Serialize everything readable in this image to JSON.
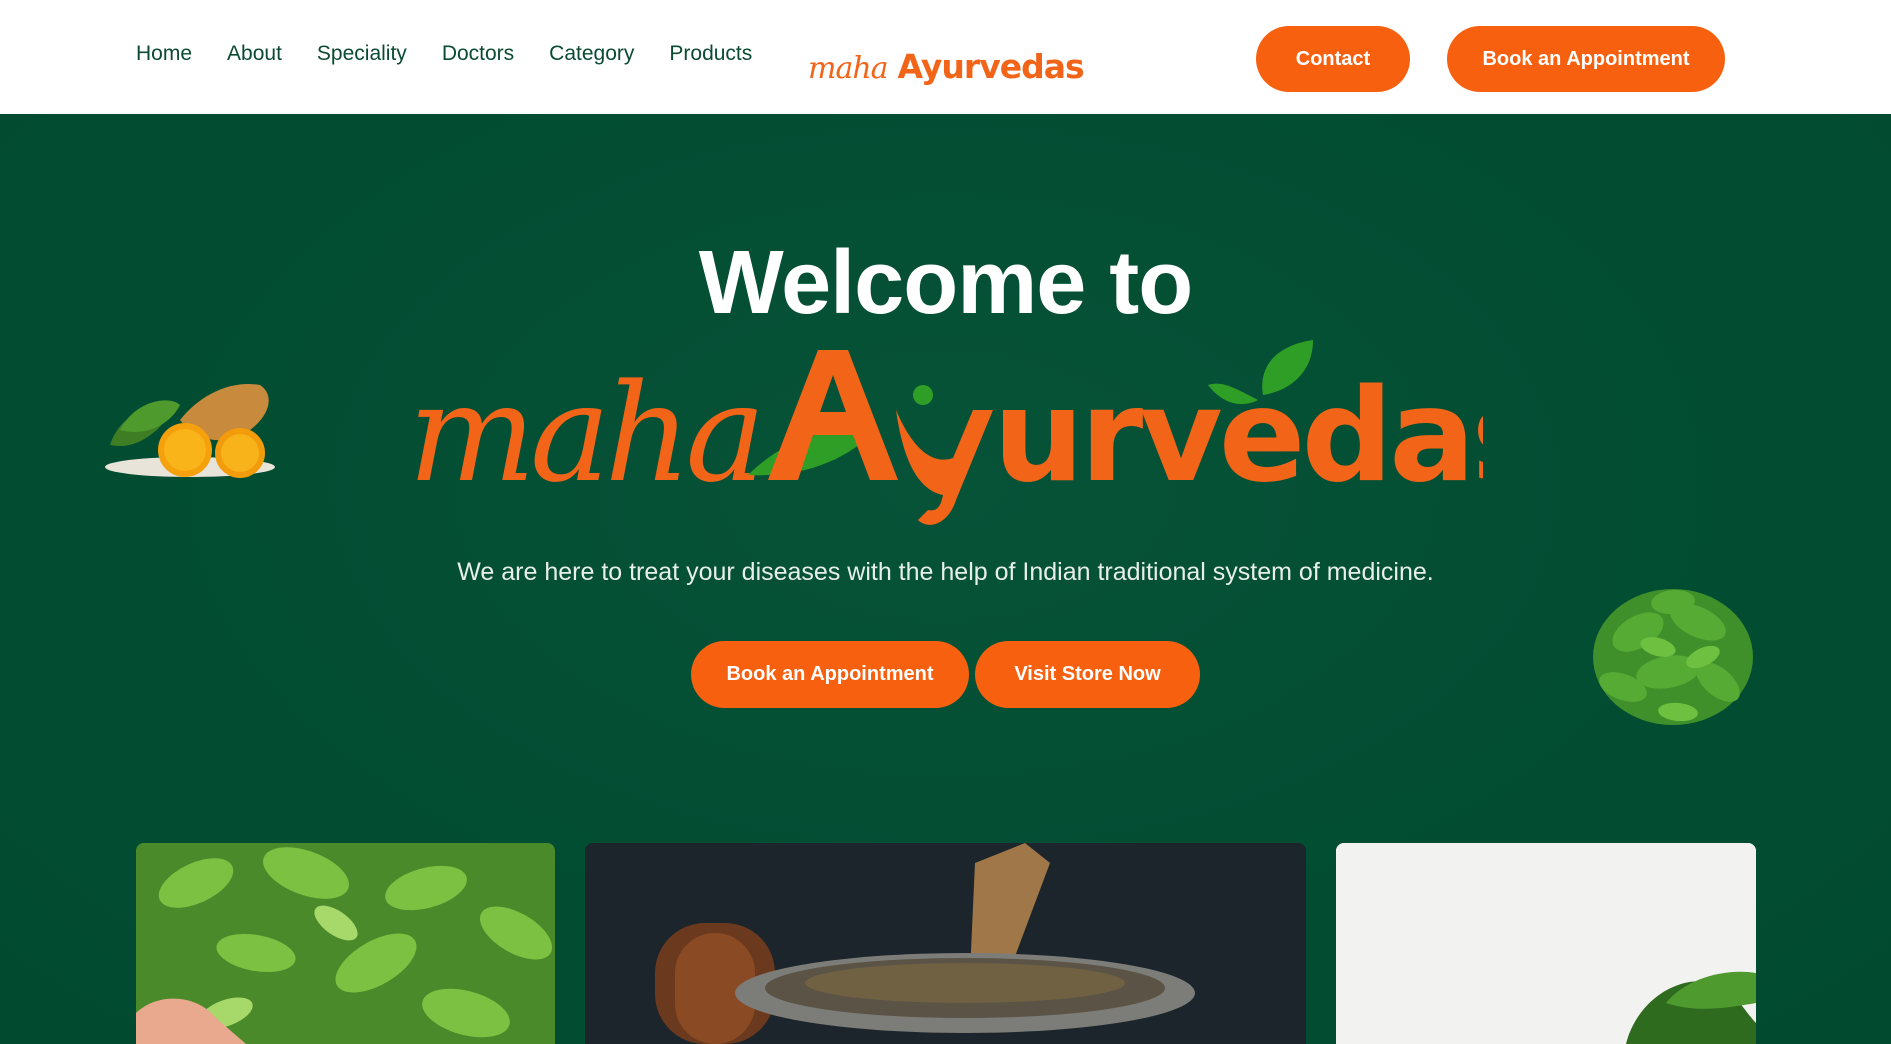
{
  "nav": {
    "items": [
      {
        "label": "Home"
      },
      {
        "label": "About"
      },
      {
        "label": "Speciality"
      },
      {
        "label": "Doctors"
      },
      {
        "label": "Category"
      },
      {
        "label": "Products"
      }
    ]
  },
  "logo": {
    "prefix": "maha",
    "name": "Ayurvedas"
  },
  "header_buttons": {
    "contact": "Contact",
    "book": "Book an Appointment"
  },
  "hero": {
    "heading": "Welcome to",
    "tagline": "We are here to treat your diseases with the help of Indian traditional system of medicine.",
    "book_button": "Book an Appointment",
    "store_button": "Visit Store Now"
  },
  "colors": {
    "brand_orange": "#f6600f",
    "brand_green": "#024d32",
    "leaf_green": "#3aa52a"
  }
}
